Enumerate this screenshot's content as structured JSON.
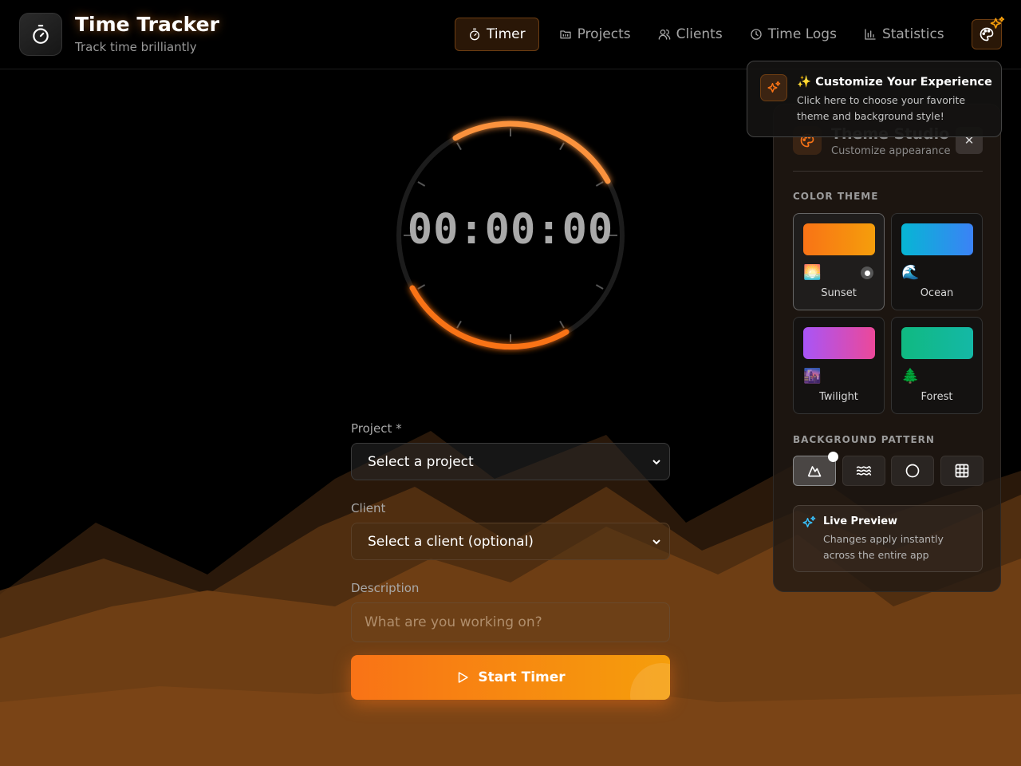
{
  "app": {
    "title": "Time Tracker",
    "subtitle": "Track time brilliantly",
    "logo_icon": "stopwatch-icon"
  },
  "nav": {
    "items": [
      {
        "label": "Timer",
        "icon": "stopwatch-icon",
        "active": true
      },
      {
        "label": "Projects",
        "icon": "folder-icon",
        "active": false
      },
      {
        "label": "Clients",
        "icon": "users-icon",
        "active": false
      },
      {
        "label": "Time Logs",
        "icon": "clock-icon",
        "active": false
      },
      {
        "label": "Statistics",
        "icon": "bar-chart-icon",
        "active": false
      }
    ],
    "palette_icon": "palette-icon"
  },
  "timer": {
    "display": "00:00:00"
  },
  "form": {
    "project_label": "Project *",
    "project_value": "Select a project",
    "client_label": "Client",
    "client_value": "Select a client (optional)",
    "description_label": "Description",
    "description_placeholder": "What are you working on?",
    "start_label": "Start Timer"
  },
  "tooltip": {
    "title": "✨ Customize Your Experience",
    "description": "Click here to choose your favorite theme and background style!"
  },
  "theme_studio": {
    "title": "Theme Studio",
    "subtitle": "Customize appearance",
    "close_label": "✕",
    "color_theme_label": "COLOR THEME",
    "themes": [
      {
        "name": "Sunset",
        "emoji": "🌅",
        "from": "#f97316",
        "to": "#f59e0b",
        "selected": true
      },
      {
        "name": "Ocean",
        "emoji": "🌊",
        "from": "#06b6d4",
        "to": "#3b82f6",
        "selected": false
      },
      {
        "name": "Twilight",
        "emoji": "🌆",
        "from": "#a855f7",
        "to": "#ec4899",
        "selected": false
      },
      {
        "name": "Forest",
        "emoji": "🌲",
        "from": "#10b981",
        "to": "#14b8a6",
        "selected": false
      }
    ],
    "background_pattern_label": "BACKGROUND PATTERN",
    "patterns": [
      {
        "icon": "mountain-icon",
        "selected": true
      },
      {
        "icon": "waves-icon",
        "selected": false
      },
      {
        "icon": "circle-icon",
        "selected": false
      },
      {
        "icon": "grid-icon",
        "selected": false
      }
    ],
    "live_preview_title": "Live Preview",
    "live_preview_desc": "Changes apply instantly across the entire app"
  },
  "colors": {
    "accent": "#f97316",
    "accent_secondary": "#f59e0b",
    "background": "#000000"
  }
}
